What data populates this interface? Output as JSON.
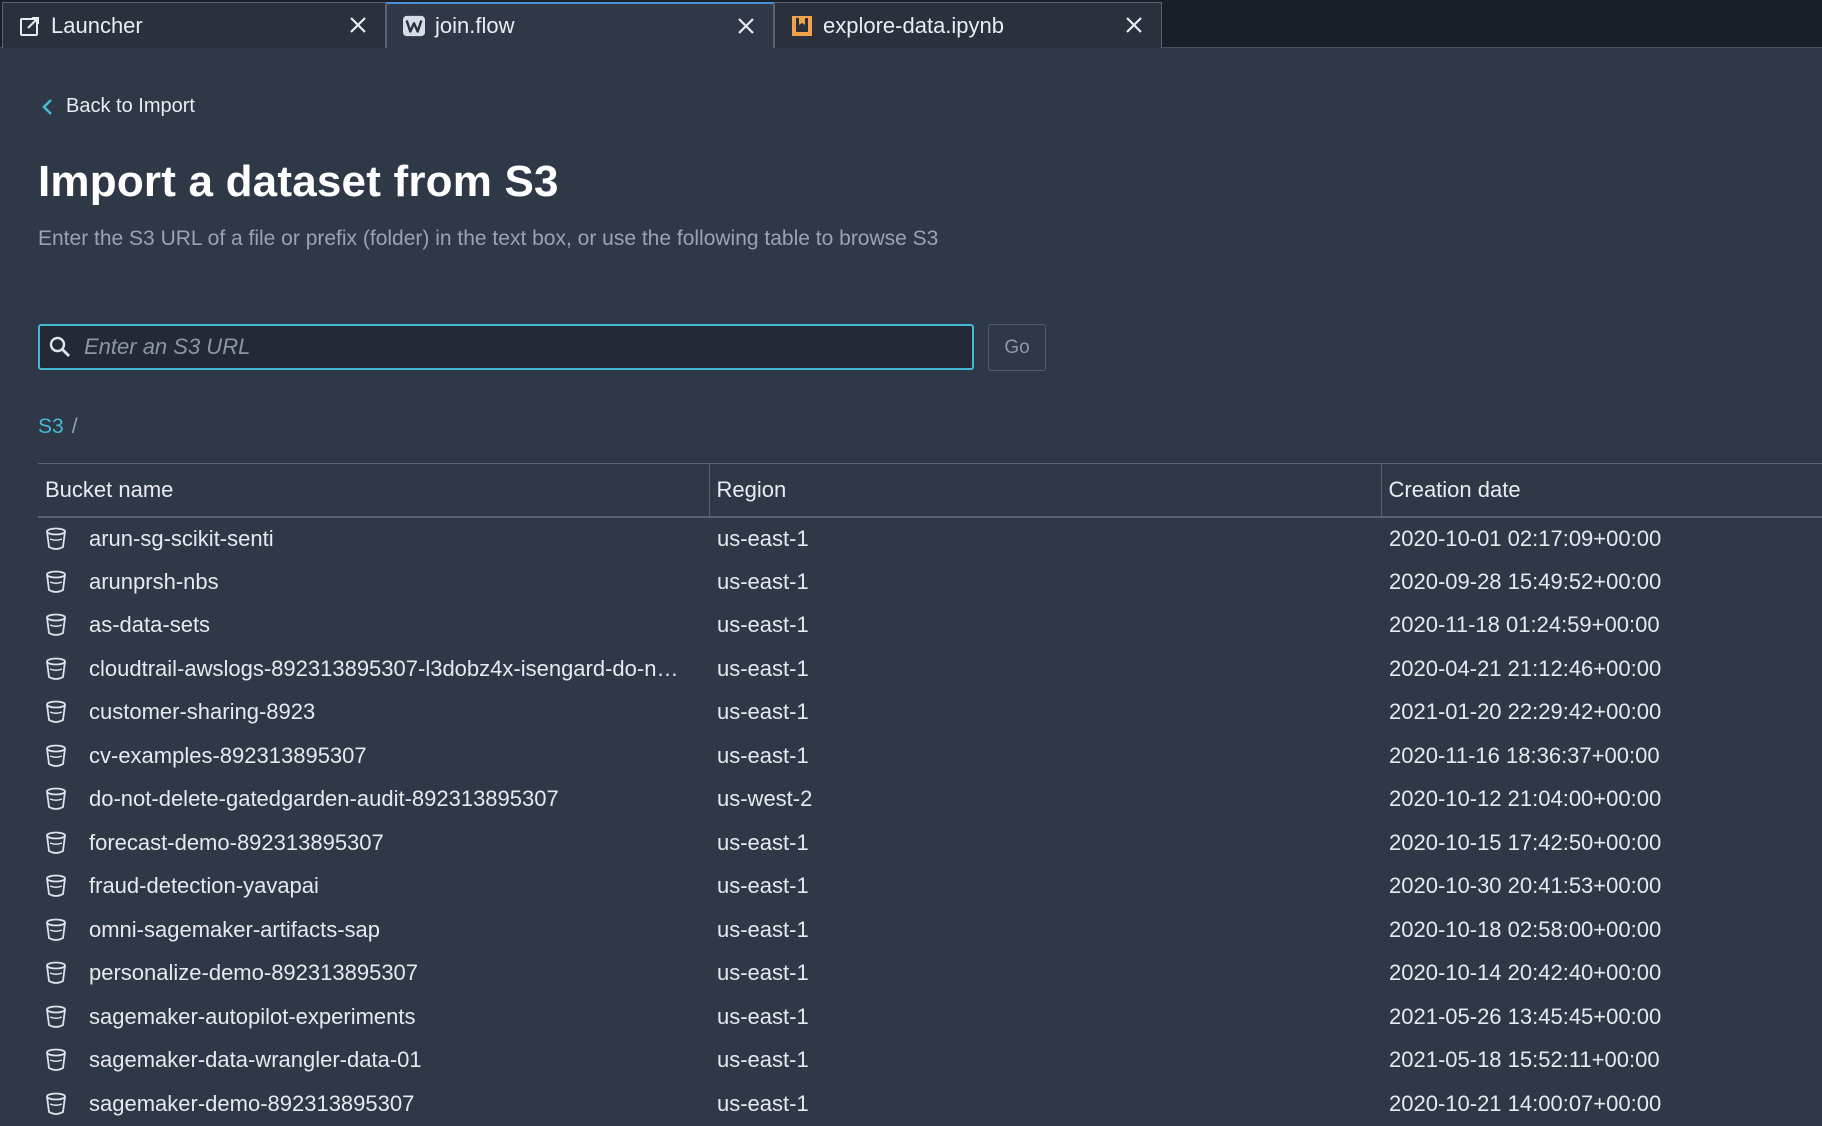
{
  "tabs": [
    {
      "label": "Launcher",
      "icon": "external-link-icon",
      "active": false
    },
    {
      "label": "join.flow",
      "icon": "data-wrangler-icon",
      "active": true
    },
    {
      "label": "explore-data.ipynb",
      "icon": "notebook-icon",
      "active": false
    }
  ],
  "back_link": {
    "label": "Back to Import"
  },
  "page": {
    "title": "Import a dataset from S3",
    "subtitle": "Enter the S3 URL of a file or prefix (folder) in the text box, or use the following table to browse S3"
  },
  "search": {
    "placeholder": "Enter an S3 URL",
    "value": "",
    "go_label": "Go"
  },
  "breadcrumb": {
    "root": "S3",
    "separator": "/"
  },
  "table": {
    "columns": [
      "Bucket name",
      "Region",
      "Creation date"
    ],
    "rows": [
      {
        "name": "arun-sg-scikit-senti",
        "region": "us-east-1",
        "created": "2020-10-01 02:17:09+00:00"
      },
      {
        "name": "arunprsh-nbs",
        "region": "us-east-1",
        "created": "2020-09-28 15:49:52+00:00"
      },
      {
        "name": "as-data-sets",
        "region": "us-east-1",
        "created": "2020-11-18 01:24:59+00:00"
      },
      {
        "name": "cloudtrail-awslogs-892313895307-l3dobz4x-isengard-do-n…",
        "region": "us-east-1",
        "created": "2020-04-21 21:12:46+00:00"
      },
      {
        "name": "customer-sharing-8923",
        "region": "us-east-1",
        "created": "2021-01-20 22:29:42+00:00"
      },
      {
        "name": "cv-examples-892313895307",
        "region": "us-east-1",
        "created": "2020-11-16 18:36:37+00:00"
      },
      {
        "name": "do-not-delete-gatedgarden-audit-892313895307",
        "region": "us-west-2",
        "created": "2020-10-12 21:04:00+00:00"
      },
      {
        "name": "forecast-demo-892313895307",
        "region": "us-east-1",
        "created": "2020-10-15 17:42:50+00:00"
      },
      {
        "name": "fraud-detection-yavapai",
        "region": "us-east-1",
        "created": "2020-10-30 20:41:53+00:00"
      },
      {
        "name": "omni-sagemaker-artifacts-sap",
        "region": "us-east-1",
        "created": "2020-10-18 02:58:00+00:00"
      },
      {
        "name": "personalize-demo-892313895307",
        "region": "us-east-1",
        "created": "2020-10-14 20:42:40+00:00"
      },
      {
        "name": "sagemaker-autopilot-experiments",
        "region": "us-east-1",
        "created": "2021-05-26 13:45:45+00:00"
      },
      {
        "name": "sagemaker-data-wrangler-data-01",
        "region": "us-east-1",
        "created": "2021-05-18 15:52:11+00:00"
      },
      {
        "name": "sagemaker-demo-892313895307",
        "region": "us-east-1",
        "created": "2020-10-21 14:00:07+00:00"
      }
    ]
  },
  "colors": {
    "accent": "#44b9d6",
    "background": "#2f3847",
    "tab_bar": "#1b1f27",
    "active_tab_border": "#4b8fd6"
  }
}
